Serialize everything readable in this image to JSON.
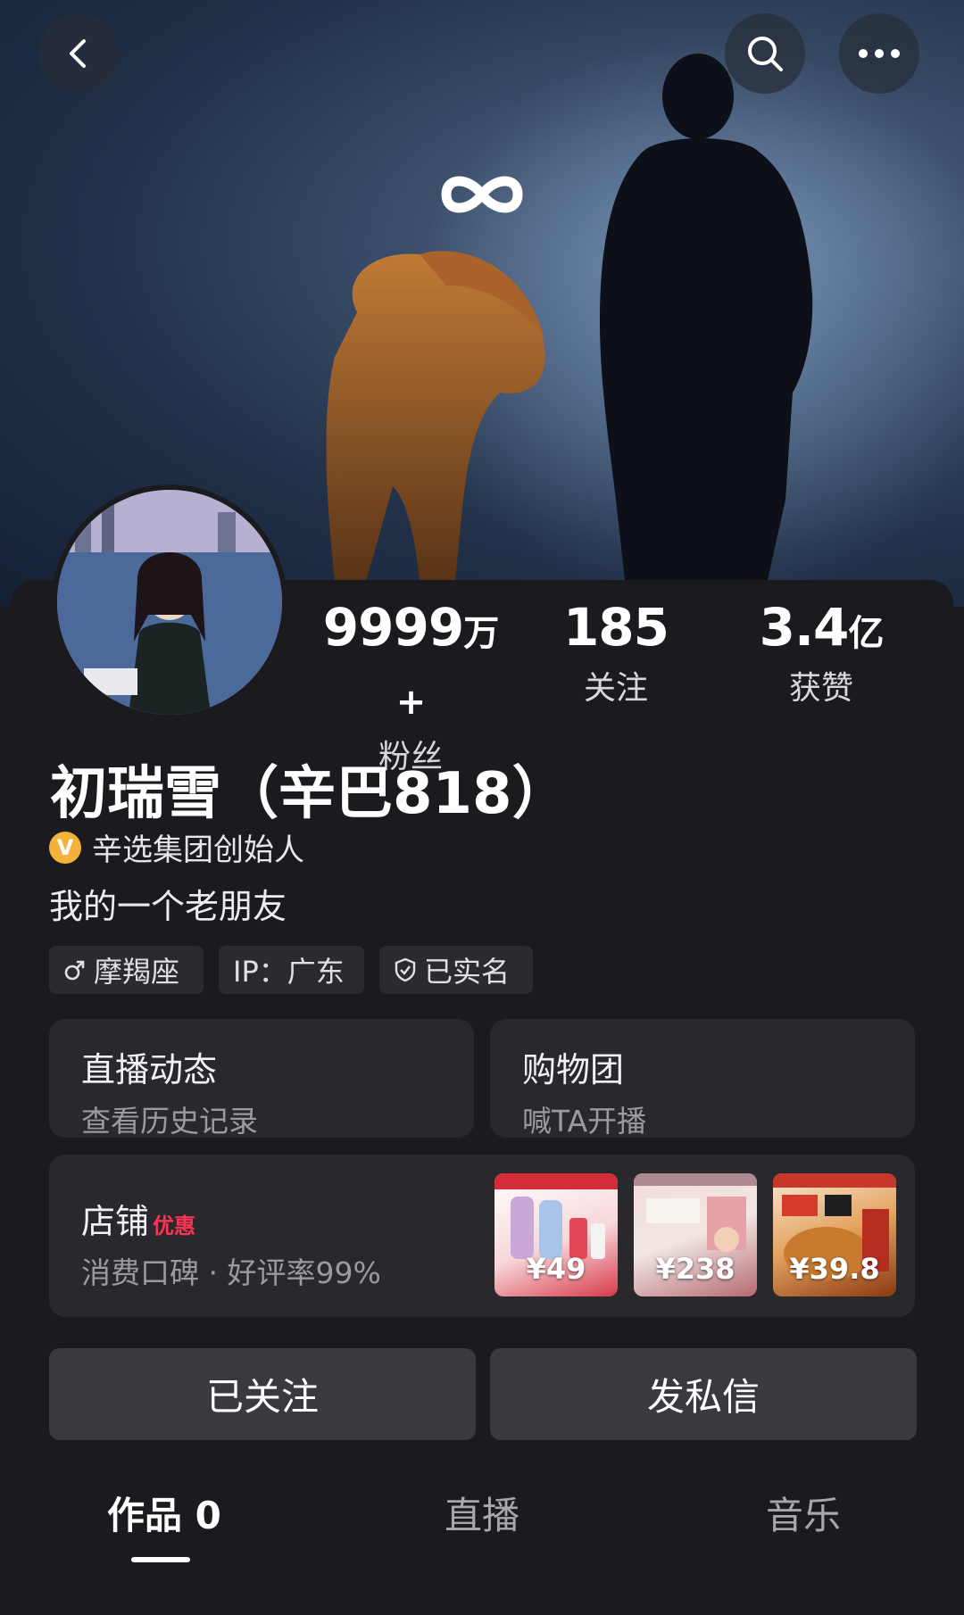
{
  "header": {
    "back_icon": "chevron-left-icon",
    "search_icon": "search-icon",
    "more_icon": "more-dots-icon"
  },
  "cover": {
    "logo": "infinity-logo"
  },
  "stats": [
    {
      "value": "9999",
      "unit": "万+",
      "label": "粉丝"
    },
    {
      "value": "185",
      "unit": "",
      "label": "关注"
    },
    {
      "value": "3.4",
      "unit": "亿",
      "label": "获赞"
    }
  ],
  "profile": {
    "name": "初瑞雪（辛巴818）",
    "verified_title": "辛选集团创始人",
    "verified_badge": "V",
    "bio": "我的一个老朋友",
    "tags": [
      {
        "icon": "male-icon",
        "label": "摩羯座"
      },
      {
        "icon": "",
        "label": "IP：广东"
      },
      {
        "icon": "shield-check-icon",
        "label": "已实名"
      }
    ]
  },
  "cards": {
    "live": {
      "title": "直播动态",
      "subtitle": "查看历史记录"
    },
    "group": {
      "title": "购物团",
      "subtitle": "喊TA开播"
    },
    "shop": {
      "title": "店铺",
      "badge": "优惠",
      "subtitle": "消费口碑 · 好评率99%",
      "products": [
        {
          "price": "¥49"
        },
        {
          "price": "¥238"
        },
        {
          "price": "¥39.8"
        }
      ]
    }
  },
  "actions": {
    "followed": "已关注",
    "message": "发私信"
  },
  "tabs": [
    {
      "label": "作品 0"
    },
    {
      "label": "直播"
    },
    {
      "label": "音乐"
    }
  ],
  "colors": {
    "background": "#1b1b1f",
    "card": "#28282d",
    "button": "#39393f",
    "badge_red": "#ff3355",
    "verify_gold": "#f5b23a"
  }
}
